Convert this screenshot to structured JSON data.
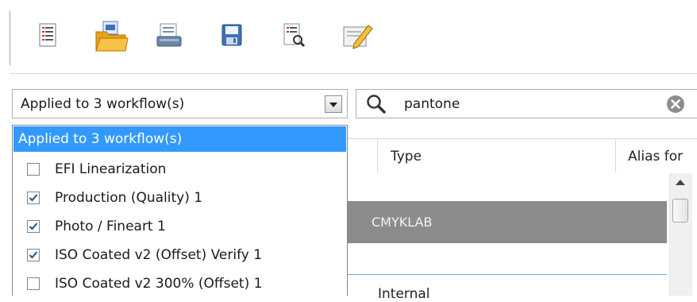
{
  "toolbar": {
    "icons": [
      "report-list-icon",
      "open-folder-icon",
      "print-icon",
      "save-disk-icon",
      "search-document-icon",
      "edit-note-icon"
    ]
  },
  "workflow_filter": {
    "selected": "Applied to 3 workflow(s)"
  },
  "search": {
    "value": "pantone"
  },
  "dropdown": {
    "header": "Applied to 3 workflow(s)",
    "items": [
      {
        "label": "EFI Linearization",
        "checked": false
      },
      {
        "label": "Production (Quality) 1",
        "checked": true
      },
      {
        "label": "Photo / Fineart 1",
        "checked": true
      },
      {
        "label": "ISO Coated v2 (Offset) Verify 1",
        "checked": true
      },
      {
        "label": "ISO Coated v2 300% (Offset) 1",
        "checked": false
      }
    ]
  },
  "table": {
    "columns": [
      "Type",
      "Alias for"
    ],
    "rows": [
      {
        "type": "CMYKLAB"
      },
      {
        "type": "Internal"
      }
    ]
  },
  "colors": {
    "selection_blue": "#3399ff",
    "selected_row_gray": "#8c8c8c"
  }
}
